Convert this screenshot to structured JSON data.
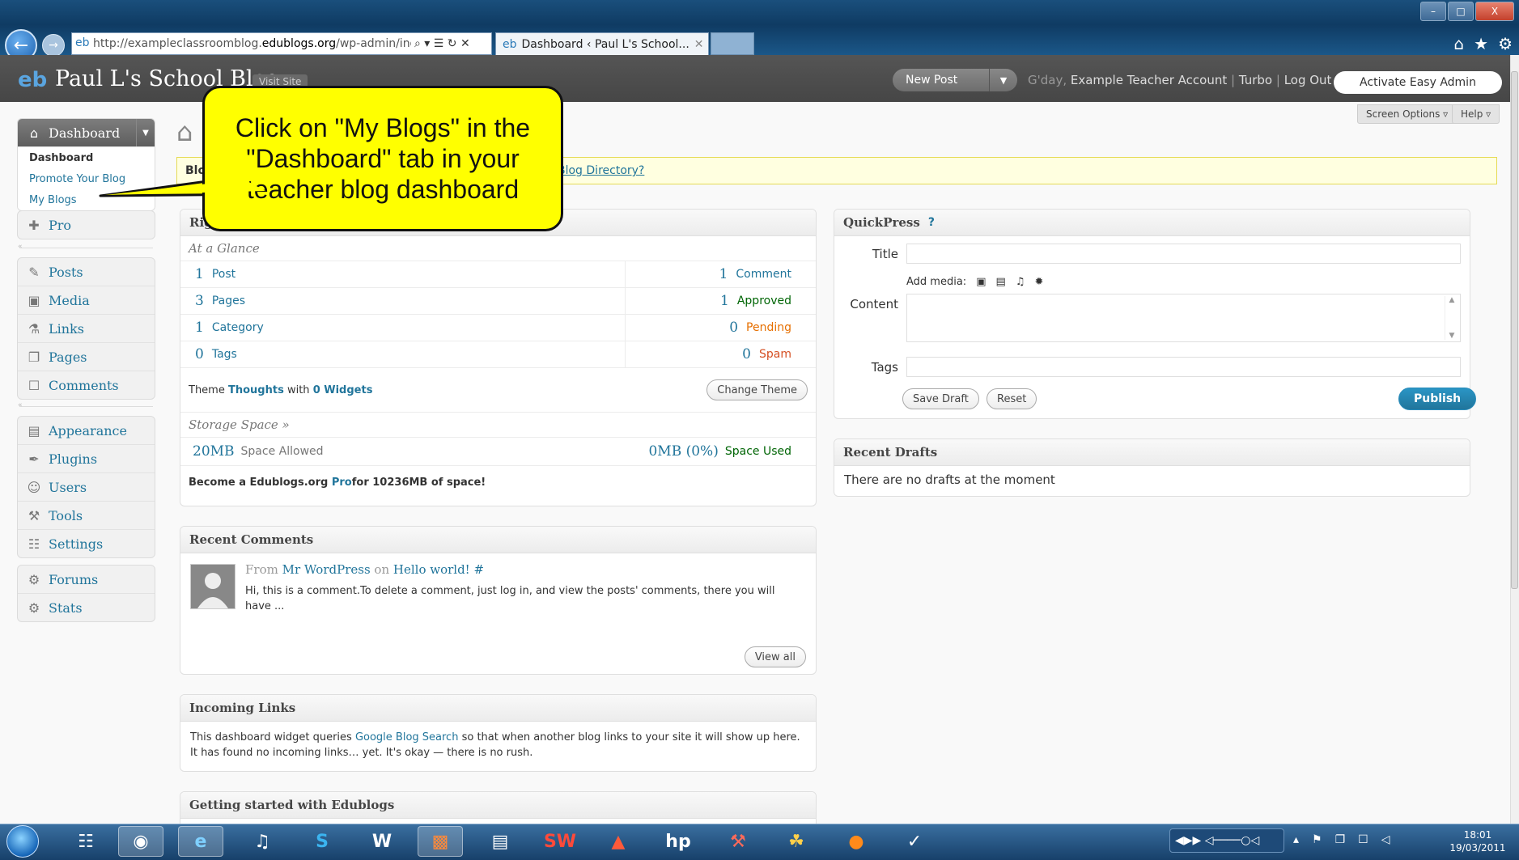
{
  "browser": {
    "url_prefix": "http://exampleclassroomblog.",
    "url_domain": "edublogs.org",
    "url_path": "/wp-admin/index.p",
    "addr_tools": "⌕ ▾ ☰ ↻ ✕",
    "tab_title": "Dashboard ‹ Paul L's School...",
    "tab_close": "✕",
    "window_buttons": [
      "–",
      "□",
      "X"
    ],
    "right_icons": [
      "⌂",
      "★",
      "⚙"
    ]
  },
  "header": {
    "logo": "eb",
    "site_title": "Paul L's School Blog",
    "visit_site": "Visit Site",
    "new_post": "New Post",
    "new_post_caret": "▼",
    "greeting": "G'day, ",
    "user": "Example Teacher Account",
    "sep1": " | ",
    "turbo": "Turbo",
    "sep2": " | ",
    "logout": "Log Out",
    "easy_admin": "Activate Easy Admin",
    "screen_options": "Screen Options ▿",
    "help": "Help ▿"
  },
  "sidebar": {
    "dashboard": {
      "label": "Dashboard",
      "icon": "⌂",
      "arrow": "▼"
    },
    "dashboard_sub": [
      "Dashboard",
      "Promote Your Blog",
      "My Blogs"
    ],
    "pro": {
      "label": "Pro",
      "icon": "✚"
    },
    "group2": [
      {
        "label": "Posts",
        "icon": "✎"
      },
      {
        "label": "Media",
        "icon": "▣"
      },
      {
        "label": "Links",
        "icon": "⚗"
      },
      {
        "label": "Pages",
        "icon": "❐"
      },
      {
        "label": "Comments",
        "icon": "☐"
      }
    ],
    "group3": [
      {
        "label": "Appearance",
        "icon": "▤"
      },
      {
        "label": "Plugins",
        "icon": "✒"
      },
      {
        "label": "Users",
        "icon": "☺"
      },
      {
        "label": "Tools",
        "icon": "⚒"
      },
      {
        "label": "Settings",
        "icon": "☷"
      }
    ],
    "group4": [
      {
        "label": "Forums",
        "icon": "⚙"
      },
      {
        "label": "Stats",
        "icon": "⚙"
      }
    ],
    "sep_dot": "«"
  },
  "notice": {
    "bold": "Blo",
    "link": "Blog Directory?"
  },
  "callout": {
    "text": "Click on \"My Blogs\" in the \"Dashboard\" tab in your teacher blog dashboard"
  },
  "right_now": {
    "title": "Righ",
    "at_a_glance": "At a Glance",
    "rows": [
      {
        "ln": "1",
        "ll": "Post",
        "rn": "1",
        "rl": "Comment"
      },
      {
        "ln": "3",
        "ll": "Pages",
        "rn": "1",
        "rl": "Approved"
      },
      {
        "ln": "1",
        "ll": "Category",
        "rn": "0",
        "rl": "Pending"
      },
      {
        "ln": "0",
        "ll": "Tags",
        "rn": "0",
        "rl": "Spam"
      }
    ],
    "theme_prefix": "Theme ",
    "theme_name": "Thoughts",
    "theme_with": " with ",
    "theme_widgets": "0 Widgets",
    "change_theme": "Change Theme",
    "storage_head": "Storage Space »",
    "space_allowed_num": "20MB",
    "space_allowed_lbl": "Space Allowed",
    "space_used_num": "0MB (0%)",
    "space_used_lbl": "Space Used",
    "pro_prefix": "Become a Edublogs.org ",
    "pro_link": "Pro",
    "pro_suffix": " for 10236MB of space!"
  },
  "recent_comments": {
    "title": "Recent Comments",
    "from": "From ",
    "author": "Mr WordPress",
    "on": " on ",
    "post": "Hello world!",
    "hash": " #",
    "excerpt": "Hi, this is a comment.To delete a comment, just log in, and view the posts' comments, there you will have ...",
    "view_all": "View all"
  },
  "incoming_links": {
    "title": "Incoming Links",
    "line1_prefix": "This dashboard widget queries ",
    "line1_link": "Google Blog Search",
    "line1_suffix": " so that when another blog links to your site it will show up here.",
    "line2": "It has found no incoming links… yet. It's okay — there is no rush."
  },
  "getting_started": {
    "title": "Getting started with Edublogs"
  },
  "quickpress": {
    "title": "QuickPress",
    "help": "?",
    "title_label": "Title",
    "add_media": "Add media:",
    "media_icons": [
      "▣",
      "▤",
      "♫",
      "✹"
    ],
    "content_label": "Content",
    "tags_label": "Tags",
    "save_draft": "Save Draft",
    "reset": "Reset",
    "publish": "Publish"
  },
  "recent_drafts": {
    "title": "Recent Drafts",
    "empty": "There are no drafts at the moment"
  },
  "taskbar": {
    "apps": [
      "☷",
      "◉",
      "e",
      "♫",
      "S",
      "W",
      "▩",
      "▤",
      "SW",
      "▲",
      "hp",
      "⚒",
      "☘",
      "●",
      "✓"
    ],
    "tray_media": "◀▶▶ ◁────○◁",
    "tray_icons": [
      "▴",
      "⚑",
      "❐",
      "☐",
      "◁"
    ],
    "time": "18:01",
    "date": "19/03/2011"
  }
}
